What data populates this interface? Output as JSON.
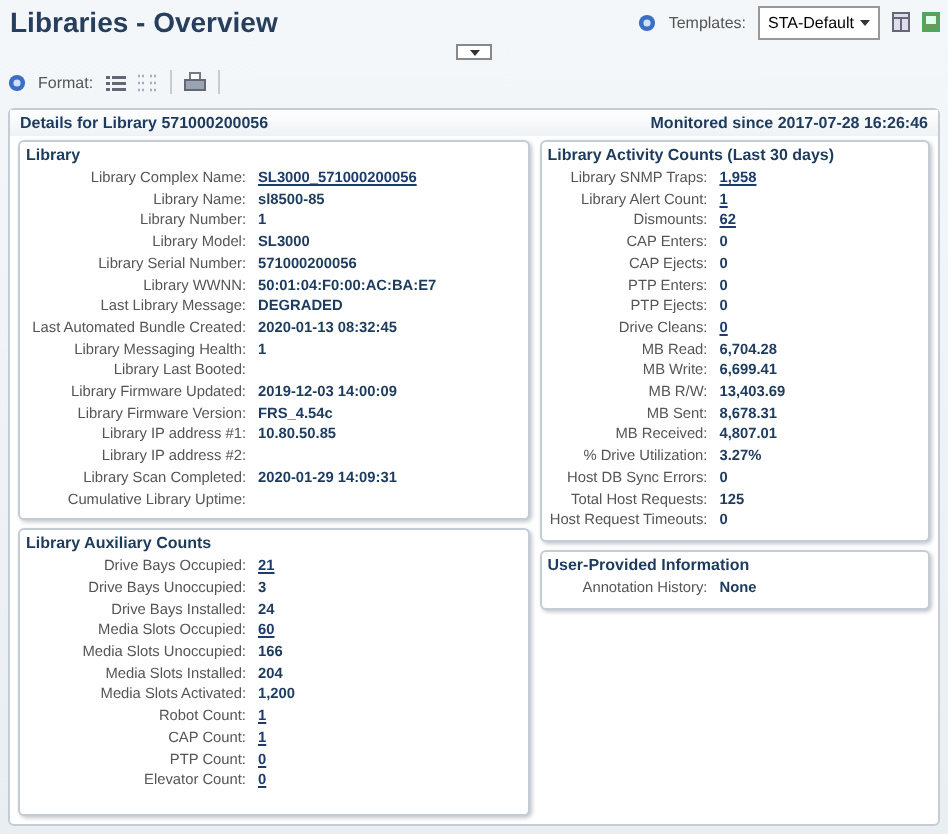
{
  "header": {
    "title": "Libraries - Overview",
    "templates_label": "Templates:",
    "template_value": "STA-Default"
  },
  "toolbar": {
    "format_label": "Format:"
  },
  "details": {
    "title": "Details for Library 571000200056",
    "monitored": "Monitored since 2017-07-28 16:26:46"
  },
  "left_panels": [
    {
      "title": "Library",
      "rows": [
        {
          "label": "Library Complex Name:",
          "value": "SL3000_571000200056",
          "kind": "link"
        },
        {
          "label": "Library Name:",
          "value": "sl8500-85",
          "kind": "text"
        },
        {
          "label": "Library Number:",
          "value": "1",
          "kind": "text"
        },
        {
          "label": "Library Model:",
          "value": "SL3000",
          "kind": "text"
        },
        {
          "label": "Library Serial Number:",
          "value": "571000200056",
          "kind": "text"
        },
        {
          "label": "Library WWNN:",
          "value": "50:01:04:F0:00:AC:BA:E7",
          "kind": "text"
        },
        {
          "label": "Last Library Message:",
          "value": "DEGRADED",
          "kind": "text"
        },
        {
          "label": "Last Automated Bundle Created:",
          "value": "2020-01-13 08:32:45",
          "kind": "text"
        },
        {
          "label": "Library Messaging Health:",
          "value": "1",
          "kind": "text"
        },
        {
          "label": "Library Last Booted:"
        },
        {
          "label": "Library Firmware Updated:",
          "value": "2019-12-03 14:00:09",
          "kind": "text"
        },
        {
          "label": "Library Firmware Version:",
          "value": "FRS_4.54c",
          "kind": "text"
        },
        {
          "label": "Library IP address #1:",
          "value": "10.80.50.85",
          "kind": "text"
        },
        {
          "label": "Library IP address #2:"
        },
        {
          "label": "Library Scan Completed:",
          "value": "2020-01-29 14:09:31",
          "kind": "text"
        },
        {
          "label": "Cumulative Library Uptime:"
        }
      ]
    },
    {
      "title": "Library Auxiliary Counts",
      "rows": [
        {
          "label": "Drive Bays Occupied:",
          "value": "21",
          "kind": "link"
        },
        {
          "label": "Drive Bays Unoccupied:",
          "value": "3",
          "kind": "text"
        },
        {
          "label": "Drive Bays Installed:",
          "value": "24",
          "kind": "text"
        },
        {
          "label": "Media Slots Occupied:",
          "value": "60",
          "kind": "link"
        },
        {
          "label": "Media Slots Unoccupied:",
          "value": "166",
          "kind": "text"
        },
        {
          "label": "Media Slots Installed:",
          "value": "204",
          "kind": "text"
        },
        {
          "label": "Media Slots Activated:",
          "value": "1,200",
          "kind": "text"
        },
        {
          "label": "Robot Count:",
          "value": "1",
          "kind": "link"
        },
        {
          "label": "CAP Count:",
          "value": "1",
          "kind": "link"
        },
        {
          "label": "PTP Count:",
          "value": "0",
          "kind": "link"
        },
        {
          "label": "Elevator Count:",
          "value": "0",
          "kind": "link"
        }
      ]
    }
  ],
  "right_panels": [
    {
      "title": "Library Activity Counts (Last 30 days)",
      "rows": [
        {
          "label": "Library SNMP Traps:",
          "value": "1,958",
          "kind": "link"
        },
        {
          "label": "Library Alert Count:",
          "value": "1",
          "kind": "link"
        },
        {
          "label": "Dismounts:",
          "value": "62",
          "kind": "link"
        },
        {
          "label": "CAP Enters:",
          "value": "0",
          "kind": "text"
        },
        {
          "label": "CAP Ejects:",
          "value": "0",
          "kind": "text"
        },
        {
          "label": "PTP Enters:",
          "value": "0",
          "kind": "text"
        },
        {
          "label": "PTP Ejects:",
          "value": "0",
          "kind": "text"
        },
        {
          "label": "Drive Cleans:",
          "value": "0",
          "kind": "link"
        },
        {
          "label": "MB Read:",
          "value": "6,704.28",
          "kind": "text"
        },
        {
          "label": "MB Write:",
          "value": "6,699.41",
          "kind": "text"
        },
        {
          "label": "MB R/W:",
          "value": "13,403.69",
          "kind": "text"
        },
        {
          "label": "MB Sent:",
          "value": "8,678.31",
          "kind": "text"
        },
        {
          "label": "MB Received:",
          "value": "4,807.01",
          "kind": "text"
        },
        {
          "label": "% Drive Utilization:",
          "value": "3.27%",
          "kind": "text"
        },
        {
          "label": "Host DB Sync Errors:",
          "value": "0",
          "kind": "text"
        },
        {
          "label": "Total Host Requests:",
          "value": "125",
          "kind": "text"
        },
        {
          "label": "Host Request Timeouts:",
          "value": "0",
          "kind": "text"
        }
      ]
    },
    {
      "title": "User-Provided Information",
      "rows": [
        {
          "label": "Annotation History:",
          "value": "None",
          "kind": "text"
        }
      ]
    }
  ]
}
